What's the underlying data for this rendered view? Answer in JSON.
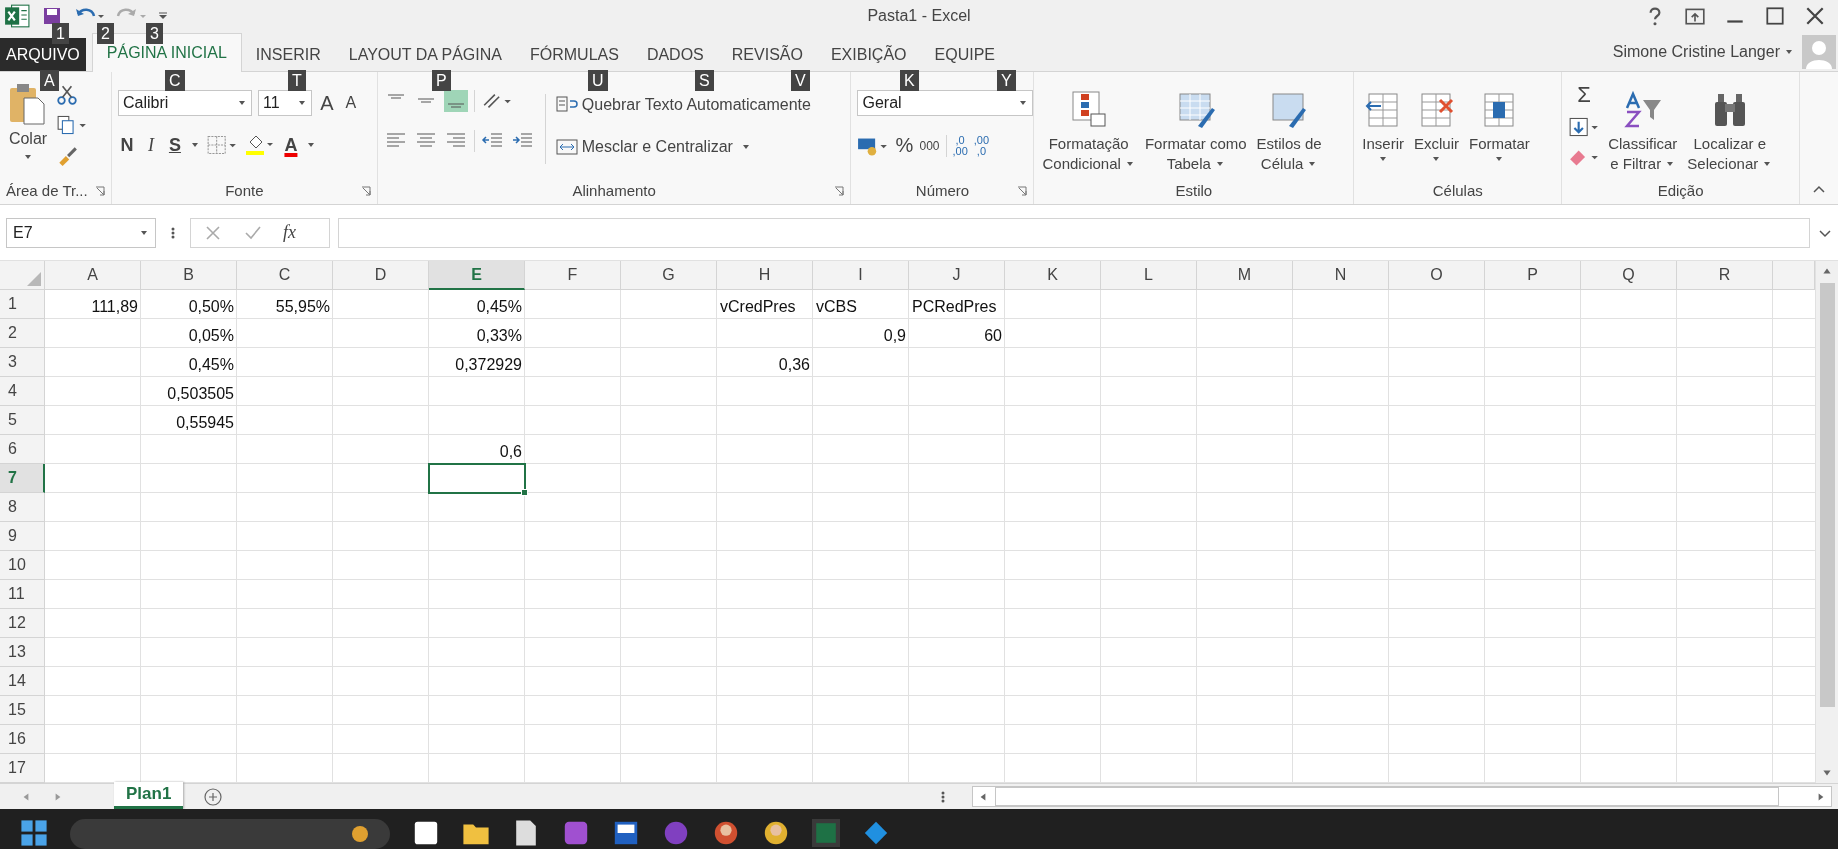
{
  "window": {
    "title": "Pasta1 - Excel"
  },
  "quick_access": {
    "key_tips": [
      "1",
      "2",
      "3"
    ]
  },
  "tabs": [
    {
      "label": "ARQUIVO",
      "selected": false,
      "kind": "file"
    },
    {
      "label": "PÁGINA INICIAL",
      "selected": true,
      "kind": "tab"
    },
    {
      "label": "INSERIR",
      "selected": false,
      "kind": "tab"
    },
    {
      "label": "LAYOUT DA PÁGINA",
      "selected": false,
      "kind": "tab"
    },
    {
      "label": "FÓRMULAS",
      "selected": false,
      "kind": "tab"
    },
    {
      "label": "DADOS",
      "selected": false,
      "kind": "tab"
    },
    {
      "label": "REVISÃO",
      "selected": false,
      "kind": "tab"
    },
    {
      "label": "EXIBIÇÃO",
      "selected": false,
      "kind": "tab"
    },
    {
      "label": "EQUIPE",
      "selected": false,
      "kind": "tab"
    }
  ],
  "user": {
    "name": "Simone Cristine Langer"
  },
  "key_tips": [
    "A",
    "C",
    "T",
    "P",
    "U",
    "S",
    "V",
    "K",
    "Y"
  ],
  "ribbon": {
    "clipboard": {
      "label": "Área de Tr...",
      "paste": "Colar"
    },
    "font": {
      "label": "Fonte",
      "font_name": "Calibri",
      "font_size": "11",
      "grow": "A",
      "shrink": "A",
      "bold": "N",
      "italic": "I",
      "underline": "S",
      "font_color": "A"
    },
    "alignment": {
      "label": "Alinhamento",
      "vertical_align": [
        {
          "selected": false
        },
        {
          "selected": false
        },
        {
          "selected": true
        }
      ],
      "wrap_text": "Quebrar Texto Automaticamente",
      "merge": "Mesclar e Centralizar"
    },
    "number": {
      "label": "Número",
      "format": "Geral",
      "percent": "%",
      "thousands": "000",
      "increase_decimal": [
        ",0",
        ",00"
      ],
      "decrease_decimal": [
        ",00",
        ",0"
      ]
    },
    "styles": {
      "label": "Estilo",
      "buttons": [
        {
          "lines": [
            "Formatação",
            "Condicional"
          ]
        },
        {
          "lines": [
            "Formatar como",
            "Tabela"
          ]
        },
        {
          "lines": [
            "Estilos de",
            "Célula"
          ]
        }
      ]
    },
    "cells": {
      "label": "Células",
      "buttons": [
        "Inserir",
        "Excluir",
        "Formatar"
      ]
    },
    "editing": {
      "label": "Edição",
      "sum": "Σ",
      "buttons": [
        {
          "lines": [
            "Classificar",
            "e Filtrar"
          ]
        },
        {
          "lines": [
            "Localizar e",
            "Selecionar"
          ]
        }
      ]
    }
  },
  "formula_bar": {
    "name_box": "E7",
    "fx": "fx"
  },
  "sheet": {
    "columns": [
      {
        "label": "A",
        "selected": false
      },
      {
        "label": "B",
        "selected": false
      },
      {
        "label": "C",
        "selected": false
      },
      {
        "label": "D",
        "selected": false
      },
      {
        "label": "E",
        "selected": true
      },
      {
        "label": "F",
        "selected": false
      },
      {
        "label": "G",
        "selected": false
      },
      {
        "label": "H",
        "selected": false
      },
      {
        "label": "I",
        "selected": false
      },
      {
        "label": "J",
        "selected": false
      },
      {
        "label": "K",
        "selected": false
      },
      {
        "label": "L",
        "selected": false
      },
      {
        "label": "M",
        "selected": false
      },
      {
        "label": "N",
        "selected": false
      },
      {
        "label": "O",
        "selected": false
      },
      {
        "label": "P",
        "selected": false
      },
      {
        "label": "Q",
        "selected": false
      },
      {
        "label": "R",
        "selected": false
      }
    ],
    "rows": [
      {
        "number": "1",
        "selected": false,
        "cells": [
          {
            "text": "111,89",
            "kind": "number"
          },
          {
            "text": "0,50%",
            "kind": "number"
          },
          {
            "text": "55,95%",
            "kind": "number"
          },
          null,
          {
            "text": "0,45%",
            "kind": "number"
          },
          null,
          null,
          {
            "text": "vCredPres",
            "kind": "text"
          },
          {
            "text": "vCBS",
            "kind": "text"
          },
          {
            "text": "PCRedPres",
            "kind": "text"
          },
          null,
          null,
          null,
          null,
          null,
          null,
          null,
          null
        ]
      },
      {
        "number": "2",
        "selected": false,
        "cells": [
          null,
          {
            "text": "0,05%",
            "kind": "number"
          },
          null,
          null,
          {
            "text": "0,33%",
            "kind": "number"
          },
          null,
          null,
          null,
          {
            "text": "0,9",
            "kind": "number"
          },
          {
            "text": "60",
            "kind": "number"
          },
          null,
          null,
          null,
          null,
          null,
          null,
          null,
          null
        ]
      },
      {
        "number": "3",
        "selected": false,
        "cells": [
          null,
          {
            "text": "0,45%",
            "kind": "number"
          },
          null,
          null,
          {
            "text": "0,372929",
            "kind": "number"
          },
          null,
          null,
          {
            "text": "0,36",
            "kind": "number"
          },
          null,
          null,
          null,
          null,
          null,
          null,
          null,
          null,
          null,
          null
        ]
      },
      {
        "number": "4",
        "selected": false,
        "cells": [
          null,
          {
            "text": "0,503505",
            "kind": "number"
          },
          null,
          null,
          null,
          null,
          null,
          null,
          null,
          null,
          null,
          null,
          null,
          null,
          null,
          null,
          null,
          null
        ]
      },
      {
        "number": "5",
        "selected": false,
        "cells": [
          null,
          {
            "text": "0,55945",
            "kind": "number"
          },
          null,
          null,
          null,
          null,
          null,
          null,
          null,
          null,
          null,
          null,
          null,
          null,
          null,
          null,
          null,
          null
        ]
      },
      {
        "number": "6",
        "selected": false,
        "cells": [
          null,
          null,
          null,
          null,
          {
            "text": "0,6",
            "kind": "number"
          },
          null,
          null,
          null,
          null,
          null,
          null,
          null,
          null,
          null,
          null,
          null,
          null,
          null
        ]
      },
      {
        "number": "7",
        "selected": true,
        "cells": [
          null,
          null,
          null,
          null,
          null,
          null,
          null,
          null,
          null,
          null,
          null,
          null,
          null,
          null,
          null,
          null,
          null,
          null
        ]
      },
      {
        "number": "8",
        "selected": false,
        "cells": [
          null,
          null,
          null,
          null,
          null,
          null,
          null,
          null,
          null,
          null,
          null,
          null,
          null,
          null,
          null,
          null,
          null,
          null
        ]
      },
      {
        "number": "9",
        "selected": false,
        "cells": [
          null,
          null,
          null,
          null,
          null,
          null,
          null,
          null,
          null,
          null,
          null,
          null,
          null,
          null,
          null,
          null,
          null,
          null
        ]
      },
      {
        "number": "10",
        "selected": false,
        "cells": [
          null,
          null,
          null,
          null,
          null,
          null,
          null,
          null,
          null,
          null,
          null,
          null,
          null,
          null,
          null,
          null,
          null,
          null
        ]
      },
      {
        "number": "11",
        "selected": false,
        "cells": [
          null,
          null,
          null,
          null,
          null,
          null,
          null,
          null,
          null,
          null,
          null,
          null,
          null,
          null,
          null,
          null,
          null,
          null
        ]
      },
      {
        "number": "12",
        "selected": false,
        "cells": [
          null,
          null,
          null,
          null,
          null,
          null,
          null,
          null,
          null,
          null,
          null,
          null,
          null,
          null,
          null,
          null,
          null,
          null
        ]
      },
      {
        "number": "13",
        "selected": false,
        "cells": [
          null,
          null,
          null,
          null,
          null,
          null,
          null,
          null,
          null,
          null,
          null,
          null,
          null,
          null,
          null,
          null,
          null,
          null
        ]
      },
      {
        "number": "14",
        "selected": false,
        "cells": [
          null,
          null,
          null,
          null,
          null,
          null,
          null,
          null,
          null,
          null,
          null,
          null,
          null,
          null,
          null,
          null,
          null,
          null
        ]
      },
      {
        "number": "15",
        "selected": false,
        "cells": [
          null,
          null,
          null,
          null,
          null,
          null,
          null,
          null,
          null,
          null,
          null,
          null,
          null,
          null,
          null,
          null,
          null,
          null
        ]
      },
      {
        "number": "16",
        "selected": false,
        "cells": [
          null,
          null,
          null,
          null,
          null,
          null,
          null,
          null,
          null,
          null,
          null,
          null,
          null,
          null,
          null,
          null,
          null,
          null
        ]
      },
      {
        "number": "17",
        "selected": false,
        "cells": [
          null,
          null,
          null,
          null,
          null,
          null,
          null,
          null,
          null,
          null,
          null,
          null,
          null,
          null,
          null,
          null,
          null,
          null
        ]
      }
    ]
  },
  "sheet_tabs": [
    {
      "label": "Plan1",
      "selected": true
    }
  ]
}
